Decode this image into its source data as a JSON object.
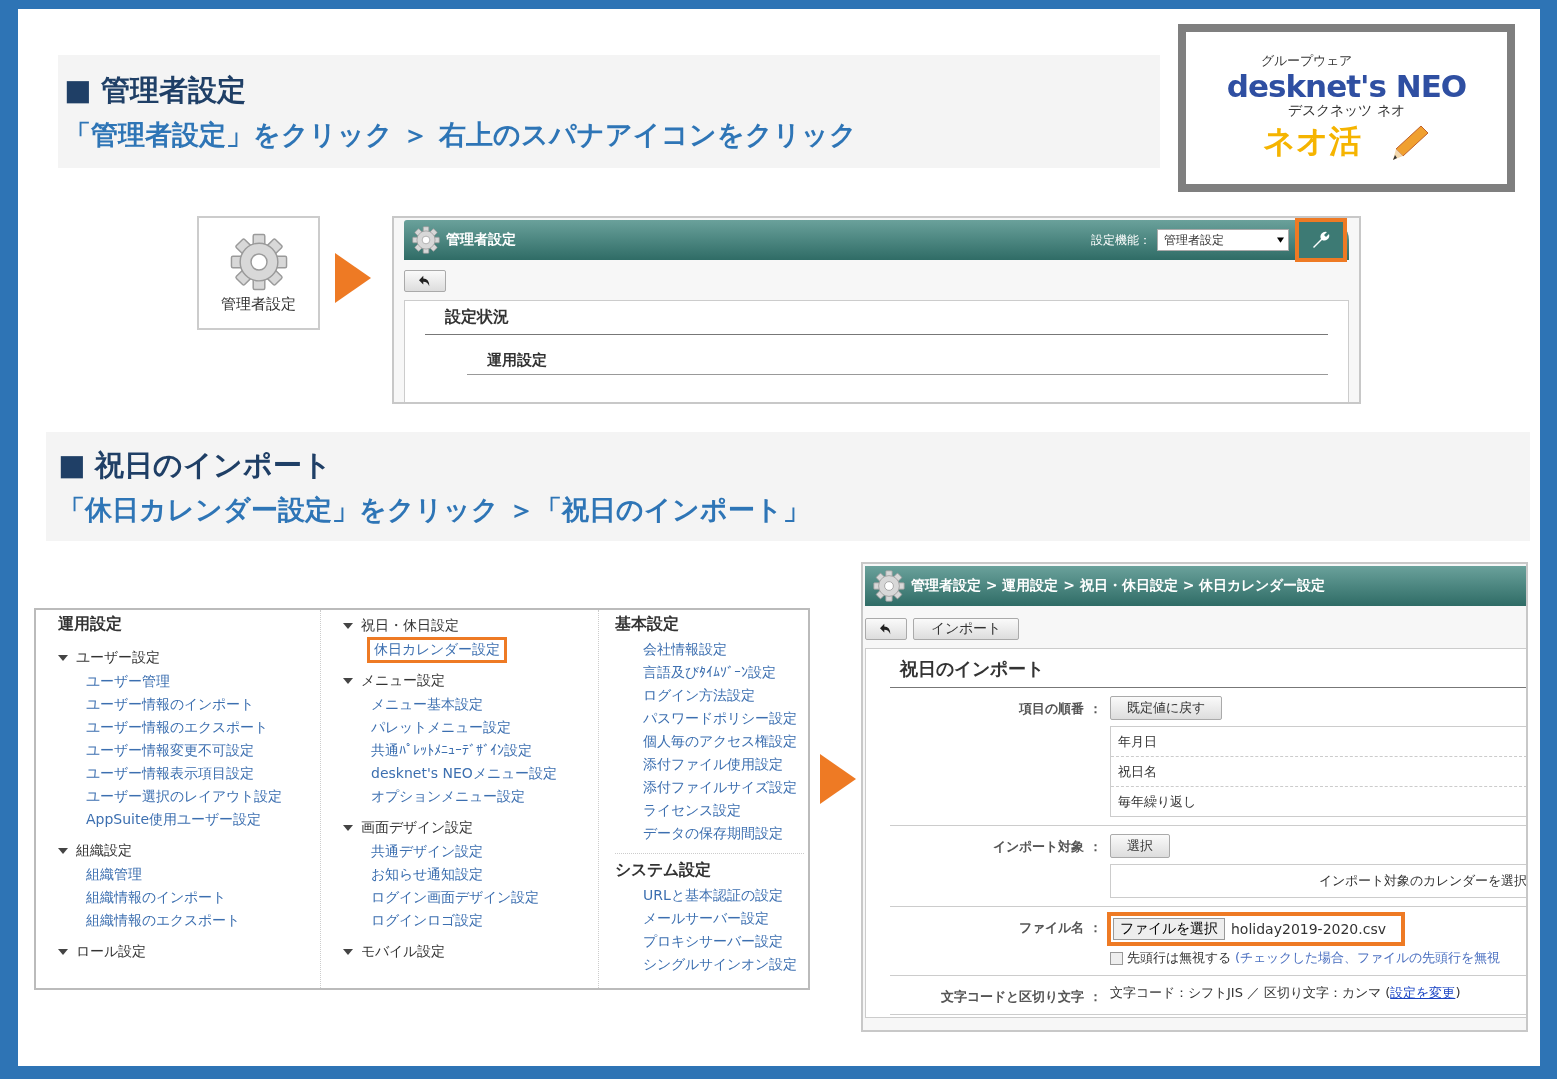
{
  "section1": {
    "title": "■ 管理者設定",
    "instruction": "「管理者設定」をクリック ＞ 右上のスパナアイコンをクリック"
  },
  "logo": {
    "tagline": "グループウェア",
    "brand": "desknet's NEO",
    "reading": "デスクネッツ ネオ",
    "slogan": "ネオ活"
  },
  "admin_tile": {
    "label": "管理者設定"
  },
  "admin_window": {
    "title": "管理者設定",
    "function_label": "設定機能：",
    "function_select": "管理者設定",
    "settings_button_highlighted": true,
    "heading": "設定状況",
    "subheading": "運用設定"
  },
  "section2": {
    "title": "■ 祝日のインポート",
    "instruction": "「休日カレンダー設定」をクリック ＞「祝日のインポート」"
  },
  "menu": {
    "columns": [
      {
        "sections": [
          {
            "kind": "heading",
            "title": "運用設定"
          },
          {
            "kind": "group",
            "title": "ユーザー設定",
            "expanded": true,
            "items": [
              {
                "label": "ユーザー管理",
                "highlighted": false
              },
              {
                "label": "ユーザー情報のインポート",
                "highlighted": false
              },
              {
                "label": "ユーザー情報のエクスポート",
                "highlighted": false
              },
              {
                "label": "ユーザー情報変更不可設定",
                "highlighted": false
              },
              {
                "label": "ユーザー情報表示項目設定",
                "highlighted": false
              },
              {
                "label": "ユーザー選択のレイアウト設定",
                "highlighted": false
              },
              {
                "label": "AppSuite使用ユーザー設定",
                "highlighted": false
              }
            ]
          },
          {
            "kind": "group",
            "title": "組織設定",
            "expanded": true,
            "items": [
              {
                "label": "組織管理",
                "highlighted": false
              },
              {
                "label": "組織情報のインポート",
                "highlighted": false
              },
              {
                "label": "組織情報のエクスポート",
                "highlighted": false
              }
            ]
          },
          {
            "kind": "group",
            "title": "ロール設定",
            "expanded": true
          }
        ]
      },
      {
        "sections": [
          {
            "kind": "group",
            "title": "祝日・休日設定",
            "expanded": true,
            "items": [
              {
                "label": "休日カレンダー設定",
                "highlighted": true
              }
            ]
          },
          {
            "kind": "group",
            "title": "メニュー設定",
            "expanded": true,
            "items": [
              {
                "label": "メニュー基本設定",
                "highlighted": false
              },
              {
                "label": "パレットメニュー設定",
                "highlighted": false
              },
              {
                "label": "共通ﾊﾟﾚｯﾄﾒﾆｭｰﾃﾞｻﾞｲﾝ設定",
                "highlighted": false
              },
              {
                "label": "desknet's NEOメニュー設定",
                "highlighted": false
              },
              {
                "label": "オプションメニュー設定",
                "highlighted": false
              }
            ]
          },
          {
            "kind": "group",
            "title": "画面デザイン設定",
            "expanded": true,
            "items": [
              {
                "label": "共通デザイン設定",
                "highlighted": false
              },
              {
                "label": "お知らせ通知設定",
                "highlighted": false
              },
              {
                "label": "ログイン画面デザイン設定",
                "highlighted": false
              },
              {
                "label": "ログインロゴ設定",
                "highlighted": false
              }
            ]
          },
          {
            "kind": "group",
            "title": "モバイル設定",
            "expanded": true
          }
        ]
      },
      {
        "sections": [
          {
            "kind": "heading",
            "title": "基本設定",
            "items": [
              {
                "label": "会社情報設定",
                "highlighted": false
              },
              {
                "label": "言語及びﾀｲﾑｿﾞｰﾝ設定",
                "highlighted": false
              },
              {
                "label": "ログイン方法設定",
                "highlighted": false
              },
              {
                "label": "パスワードポリシー設定",
                "highlighted": false
              },
              {
                "label": "個人毎のアクセス権設定",
                "highlighted": false
              },
              {
                "label": "添付ファイル使用設定",
                "highlighted": false
              },
              {
                "label": "添付ファイルサイズ設定",
                "highlighted": false
              },
              {
                "label": "ライセンス設定",
                "highlighted": false
              },
              {
                "label": "データの保存期間設定",
                "highlighted": false
              }
            ]
          },
          {
            "kind": "heading",
            "title": "システム設定",
            "items": [
              {
                "label": "URLと基本認証の設定",
                "highlighted": false
              },
              {
                "label": "メールサーバー設定",
                "highlighted": false
              },
              {
                "label": "プロキシサーバー設定",
                "highlighted": false
              },
              {
                "label": "シングルサインオン設定",
                "highlighted": false
              }
            ]
          }
        ]
      }
    ]
  },
  "import_window": {
    "breadcrumb": "管理者設定 > 運用設定 > 祝日・休日設定 > 休日カレンダー設定",
    "import_button": "インポート",
    "heading": "祝日のインポート",
    "rows": [
      {
        "kind": "order",
        "label": "項目の順番 ：",
        "button": "既定値に戻す",
        "items": [
          "年月日",
          "祝日名",
          "毎年繰り返し"
        ]
      },
      {
        "kind": "target",
        "label": "インポート対象 ：",
        "button": "選択",
        "hint": "インポート対象のカレンダーを選択"
      },
      {
        "kind": "file",
        "label": "ファイル名 ：",
        "button": "ファイルを選択",
        "file": "holiday2019-2020.csv",
        "highlighted": true,
        "checkbox_label": "先頭行は無視する",
        "checked": false,
        "note": "(チェックした場合、ファイルの先頭行を無視"
      },
      {
        "kind": "encoding",
        "label": "文字コードと区切り文字 ：",
        "text_before": "文字コード：シフトJIS ／ 区切り文字：カンマ (",
        "link": "設定を変更",
        "text_after": ")"
      }
    ]
  }
}
